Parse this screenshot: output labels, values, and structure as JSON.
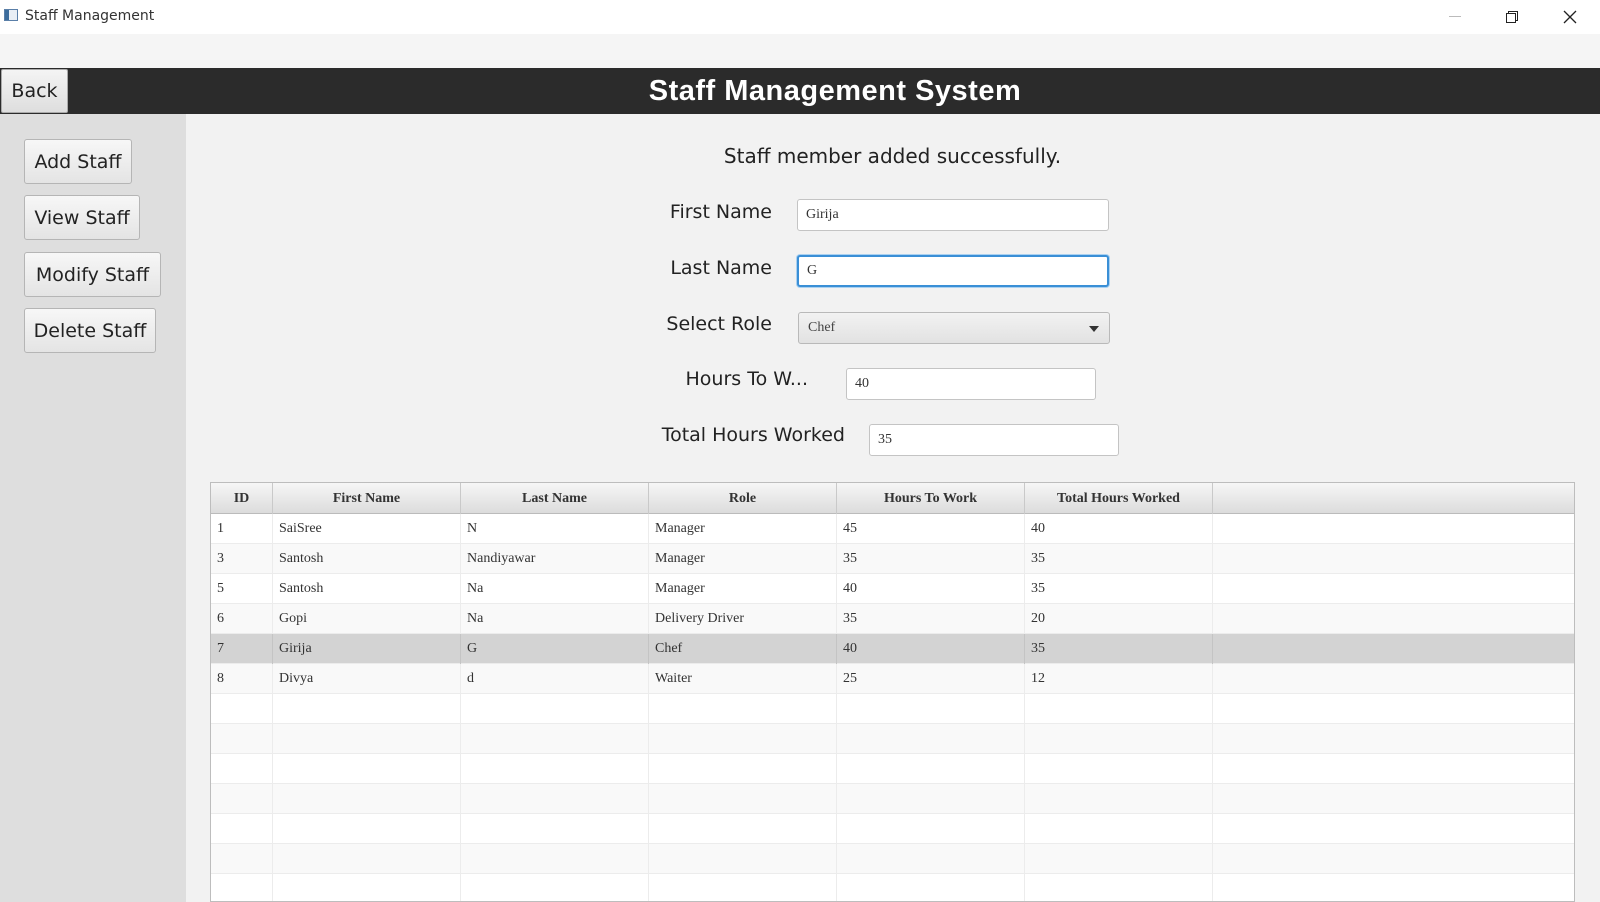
{
  "window": {
    "title": "Staff Management",
    "minimize_icon": "minimize-icon",
    "maximize_icon": "restore-icon",
    "close_icon": "close-icon"
  },
  "header": {
    "back_label": "Back",
    "title": "Staff Management System"
  },
  "sidebar": {
    "items": [
      {
        "label": "Add Staff"
      },
      {
        "label": "View Staff"
      },
      {
        "label": "Modify Staff"
      },
      {
        "label": "Delete Staff"
      }
    ]
  },
  "form": {
    "status_message": "Staff member added successfully.",
    "first_name_label": "First Name",
    "first_name_value": "Girija",
    "last_name_label": "Last Name",
    "last_name_value": "G",
    "role_label": "Select Role",
    "role_value": "Chef",
    "hours_label": "Hours To W...",
    "hours_value": "40",
    "total_hours_label": "Total Hours Worked",
    "total_hours_value": "35"
  },
  "table": {
    "columns": [
      "ID",
      "First Name",
      "Last Name",
      "Role",
      "Hours To Work",
      "Total Hours Worked"
    ],
    "rows": [
      [
        "1",
        "SaiSree",
        "N",
        "Manager",
        "45",
        "40"
      ],
      [
        "3",
        "Santosh",
        "Nandiyawar",
        "Manager",
        "35",
        "35"
      ],
      [
        "5",
        "Santosh",
        "Na",
        "Manager",
        "40",
        "35"
      ],
      [
        "6",
        "Gopi",
        "Na",
        "Delivery Driver",
        "35",
        "20"
      ],
      [
        "7",
        "Girija",
        "G",
        "Chef",
        "40",
        "35"
      ],
      [
        "8",
        "Divya",
        "d",
        "Waiter",
        "25",
        "12"
      ]
    ],
    "selected_row": 4,
    "empty_rows": 7
  }
}
